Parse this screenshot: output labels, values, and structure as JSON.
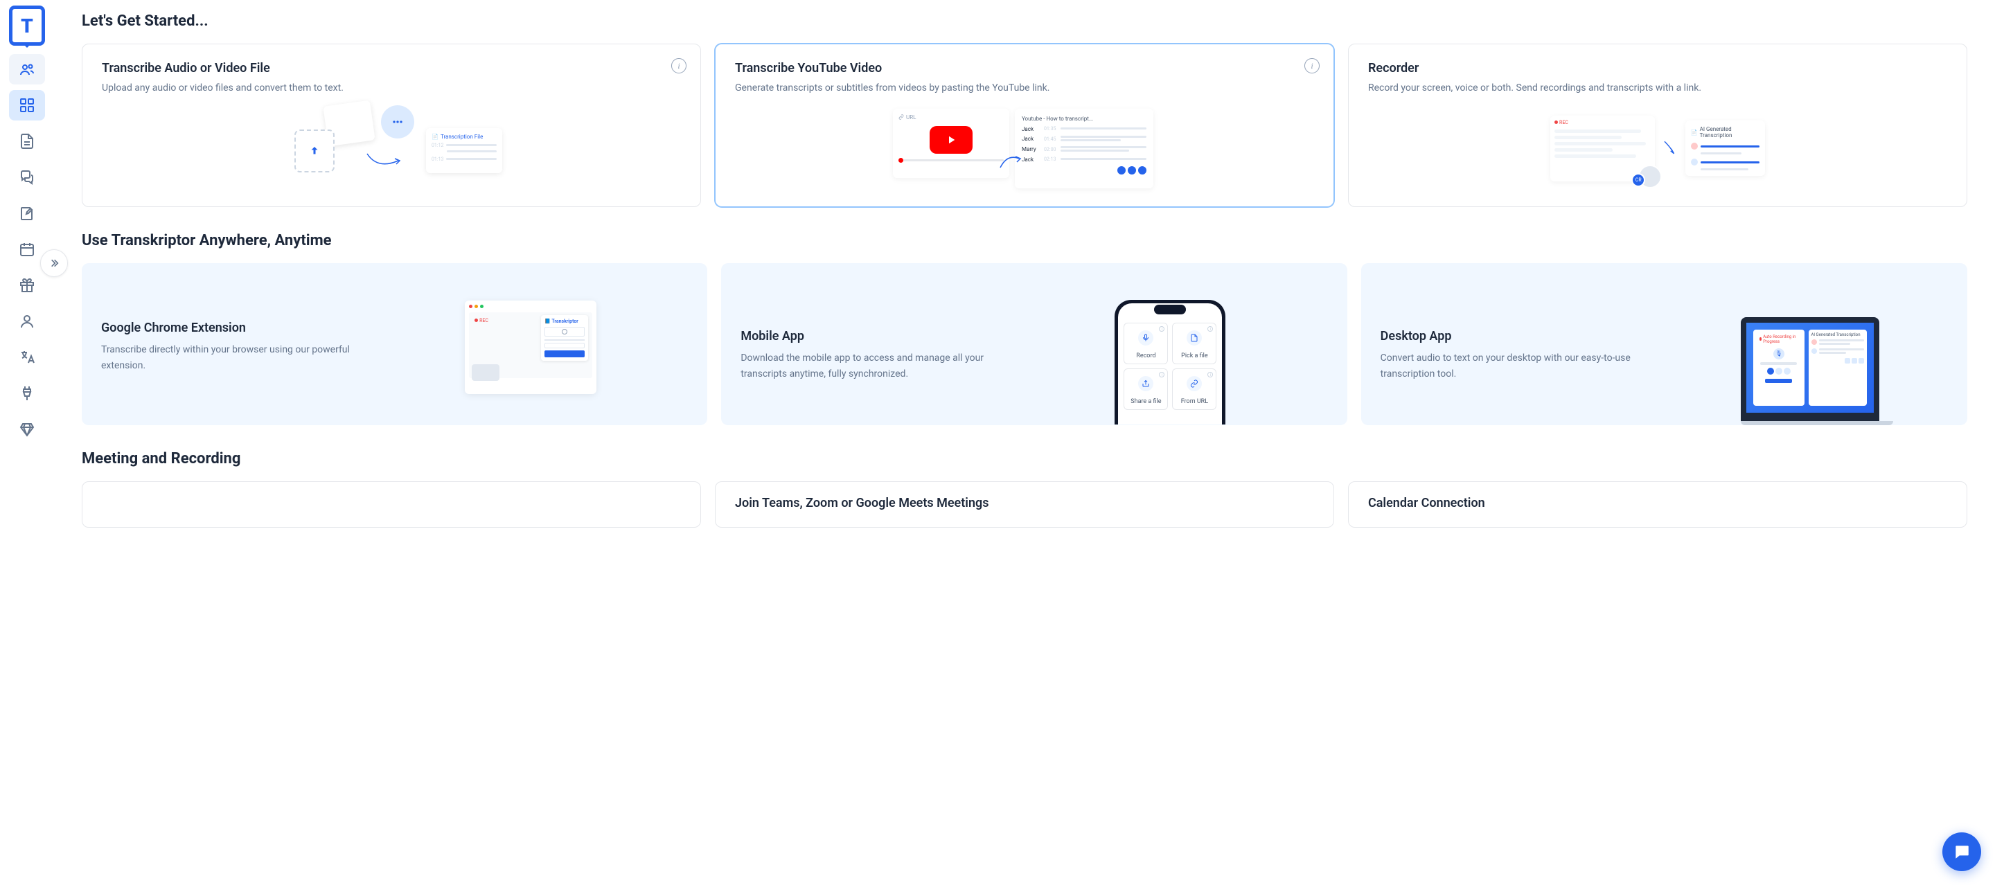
{
  "sections": {
    "getStarted": "Let's Get Started...",
    "anywhere": "Use Transkriptor Anywhere, Anytime",
    "meeting": "Meeting and Recording"
  },
  "cards": {
    "upload": {
      "title": "Transcribe Audio or Video File",
      "desc": "Upload any audio or video files and convert them to text."
    },
    "youtube": {
      "title": "Transcribe YouTube Video",
      "desc": "Generate transcripts or subtitles from videos by pasting the YouTube link."
    },
    "recorder": {
      "title": "Recorder",
      "desc": "Record your screen, voice or both. Send recordings and transcripts with a link."
    }
  },
  "apps": {
    "chrome": {
      "title": "Google Chrome Extension",
      "desc": "Transcribe directly within your browser using our powerful extension."
    },
    "mobile": {
      "title": "Mobile App",
      "desc": "Download the mobile app to access and manage all your transcripts anytime, fully synchronized."
    },
    "desktop": {
      "title": "Desktop App",
      "desc": "Convert audio to text on your desktop with our easy-to-use transcription tool."
    }
  },
  "meeting": {
    "join": {
      "title": "Join Teams, Zoom or Google Meets Meetings"
    },
    "calendar": {
      "title": "Calendar Connection"
    }
  },
  "viz": {
    "uploadFile": "Transcription File",
    "time1": "01:12",
    "time2": "01:13",
    "url": "URL",
    "ytHeader": "Youtube - How to transcript...",
    "jack": "Jack",
    "marry": "Marry",
    "t1": "01:35",
    "t2": "01:45",
    "t3": "02:00",
    "t4": "02:13",
    "rec": "REC",
    "aiGen": "AI Generated Transcription",
    "transkriptor": "Transkriptor",
    "recordLabel": "Record",
    "pickFile": "Pick a file",
    "shareFile": "Share a file",
    "fromUrl": "From URL",
    "autoRec": "Auto Recording in Progress",
    "cr": "CR"
  }
}
